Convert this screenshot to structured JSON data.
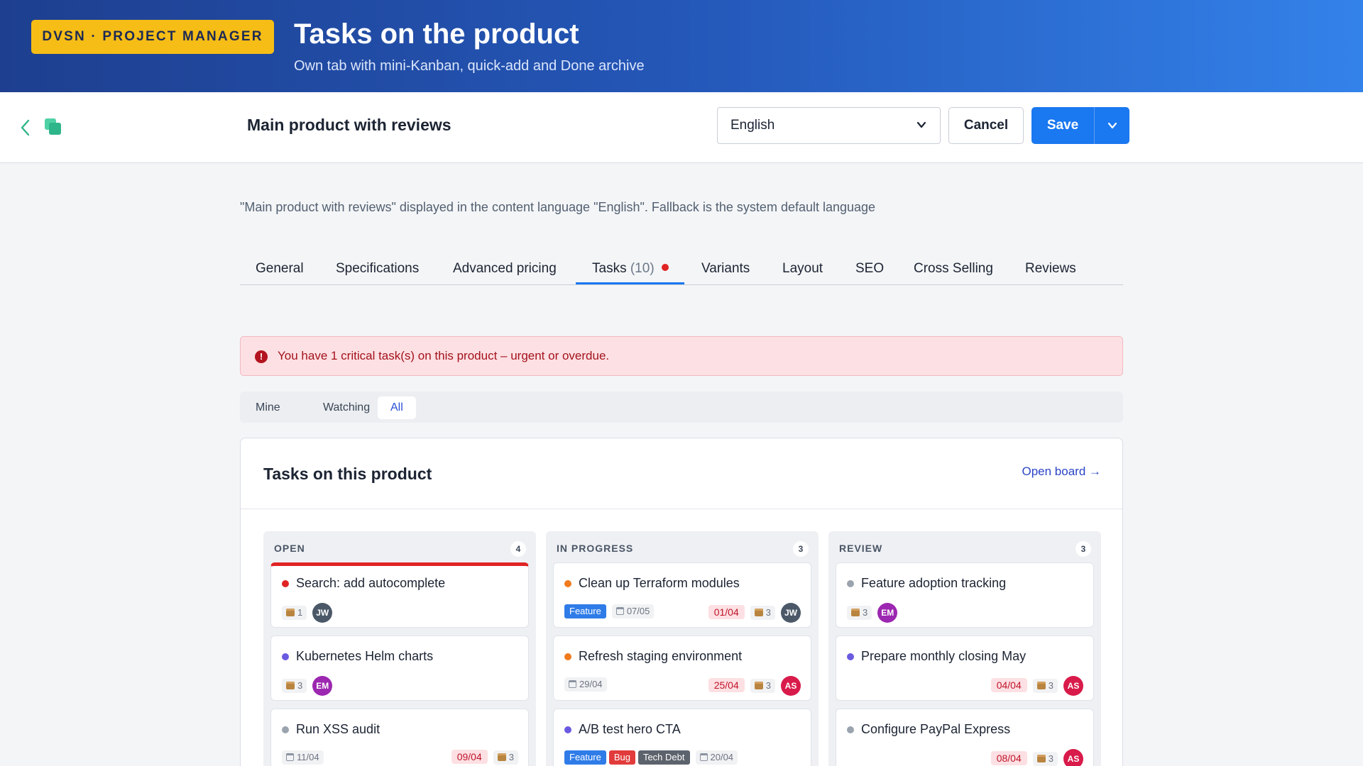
{
  "hero": {
    "badge": "DVSN · PROJECT MANAGER",
    "title": "Tasks on the product",
    "subtitle": "Own tab with mini-Kanban, quick-add and Done archive"
  },
  "header": {
    "product_title": "Main product with reviews",
    "language": "English",
    "cancel_label": "Cancel",
    "save_label": "Save",
    "icons": {
      "back": "chevron-left-icon",
      "copy": "copy-icon",
      "dropdown": "chevron-down-icon"
    }
  },
  "info_text": "\"Main product with reviews\" displayed in the content language \"English\". Fallback is the system default language",
  "tabs": [
    {
      "label": "General"
    },
    {
      "label": "Specifications"
    },
    {
      "label": "Advanced pricing"
    },
    {
      "label": "Tasks",
      "count": "(10)",
      "active": true
    },
    {
      "label": "Variants"
    },
    {
      "label": "Layout"
    },
    {
      "label": "SEO"
    },
    {
      "label": "Cross Selling"
    },
    {
      "label": "Reviews"
    }
  ],
  "alert": {
    "icon": "!",
    "text": "You have 1 critical task(s) on this product – urgent or overdue."
  },
  "filters": [
    {
      "label": "Mine"
    },
    {
      "label": "Watching"
    },
    {
      "label": "All",
      "active": true
    }
  ],
  "panel": {
    "title": "Tasks on this product",
    "open_board": "Open board →"
  },
  "colors": {
    "accent": "#1a78f0",
    "critical": "#e02424",
    "orange": "#f07b1d",
    "purple": "#6a5ae0",
    "gray": "#9aa3ae"
  },
  "columns": [
    {
      "title": "OPEN",
      "count": "4",
      "cards": [
        {
          "title": "Search: add autocomplete",
          "priority": "critical",
          "box": "1",
          "avatar": "JW"
        },
        {
          "title": "Kubernetes Helm charts",
          "priority": "purple",
          "box": "3",
          "avatar": "EM"
        },
        {
          "title": "Run XSS audit",
          "priority": "gray",
          "date": "11/04",
          "due": "09/04",
          "box": "3"
        }
      ]
    },
    {
      "title": "IN PROGRESS",
      "count": "3",
      "cards": [
        {
          "title": "Clean up Terraform modules",
          "priority": "orange",
          "tags": [
            "Feature"
          ],
          "date": "07/05",
          "due": "01/04",
          "box": "3",
          "avatar": "JW"
        },
        {
          "title": "Refresh staging environment",
          "priority": "orange",
          "date": "29/04",
          "due": "25/04",
          "box": "3",
          "avatar": "AS"
        },
        {
          "title": "A/B test hero CTA",
          "priority": "purple",
          "tags": [
            "Feature",
            "Bug",
            "Tech Debt"
          ],
          "date": "20/04"
        }
      ]
    },
    {
      "title": "REVIEW",
      "count": "3",
      "cards": [
        {
          "title": "Feature adoption tracking",
          "priority": "gray",
          "box": "3",
          "avatar": "EM"
        },
        {
          "title": "Prepare monthly closing May",
          "priority": "purple",
          "due": "04/04",
          "box": "3",
          "avatar": "AS"
        },
        {
          "title": "Configure PayPal Express",
          "priority": "gray",
          "due": "08/04",
          "box": "3",
          "avatar": "AS"
        }
      ]
    }
  ]
}
